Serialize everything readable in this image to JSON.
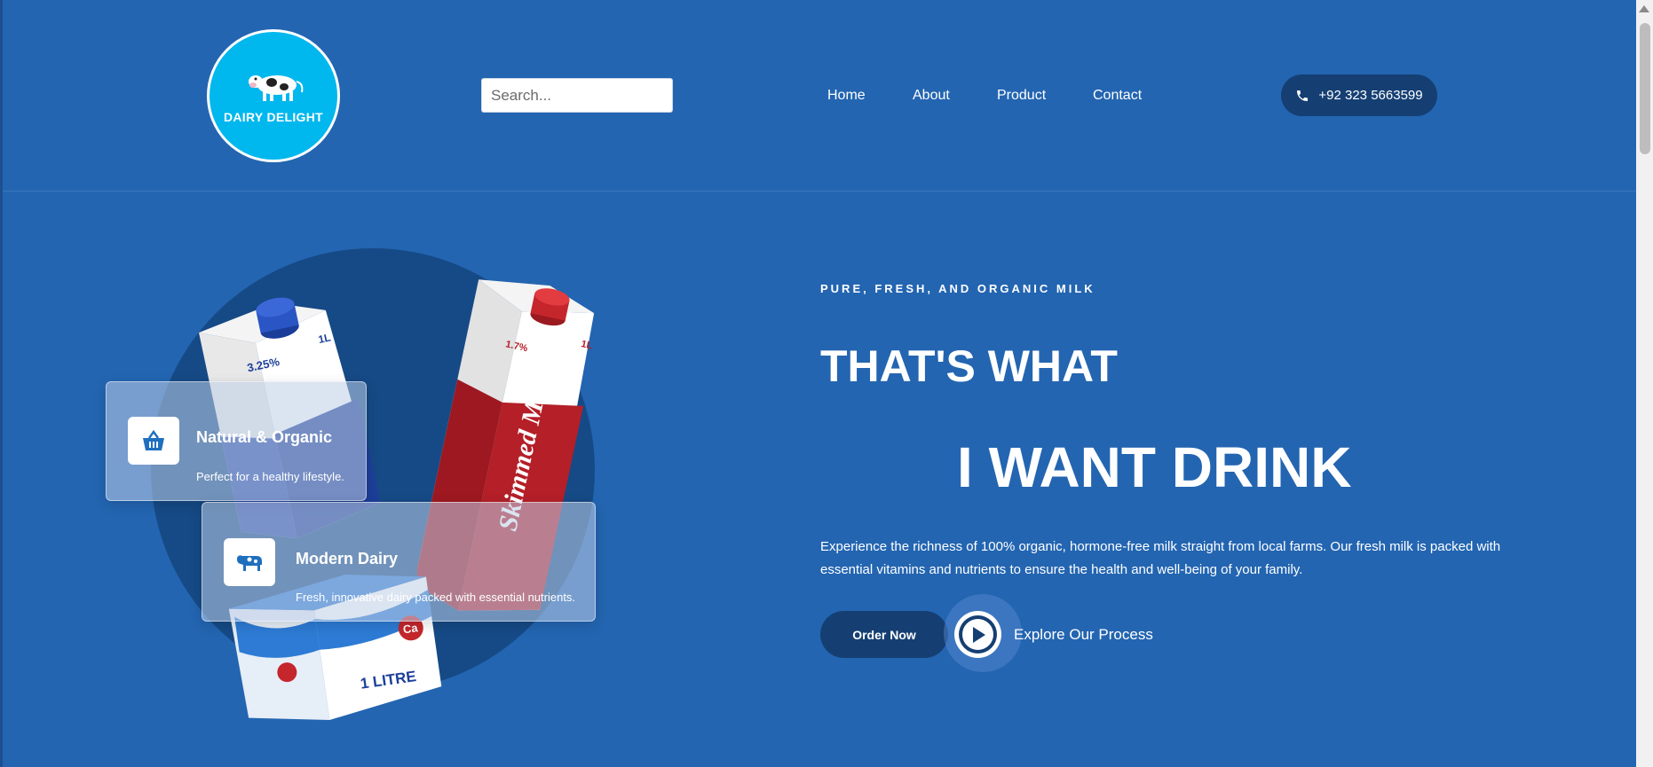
{
  "brand": {
    "name": "DAIRY DELIGHT",
    "logo_icon": "cow-icon"
  },
  "search": {
    "placeholder": "Search..."
  },
  "nav": {
    "items": [
      "Home",
      "About",
      "Product",
      "Contact"
    ]
  },
  "contact": {
    "phone": "+92 323 5663599",
    "icon": "phone-icon"
  },
  "hero": {
    "eyebrow": "PURE, FRESH, AND ORGANIC MILK",
    "headline_line1": "THAT'S WHAT",
    "headline_line2": "I WANT DRINK",
    "description": "Experience the richness of 100% organic, hormone-free milk straight from local farms. Our fresh milk is packed with essential vitamins and nutrients to ensure the health and well-being of your family.",
    "order_label": "Order Now",
    "explore_label": "Explore Our Process"
  },
  "features": [
    {
      "title": "Natural & Organic",
      "desc": "Perfect for a healthy lifestyle.",
      "icon": "basket-icon"
    },
    {
      "title": "Modern Dairy",
      "desc": "Fresh, innovative dairy packed with essential nutrients.",
      "icon": "cow-icon"
    }
  ],
  "cartons": [
    {
      "percent": "3.25%",
      "size": "1L",
      "cap_color": "#1f4fb5"
    },
    {
      "percent": "1.7%",
      "size": "1L",
      "brand": "Skimmed Milk",
      "cap_color": "#c0262b"
    },
    {
      "size": "1 LITRE",
      "badge": "Ca"
    }
  ],
  "colors": {
    "background": "#2365b1",
    "navy": "#153f73",
    "logo_blue": "#00b7ee"
  }
}
